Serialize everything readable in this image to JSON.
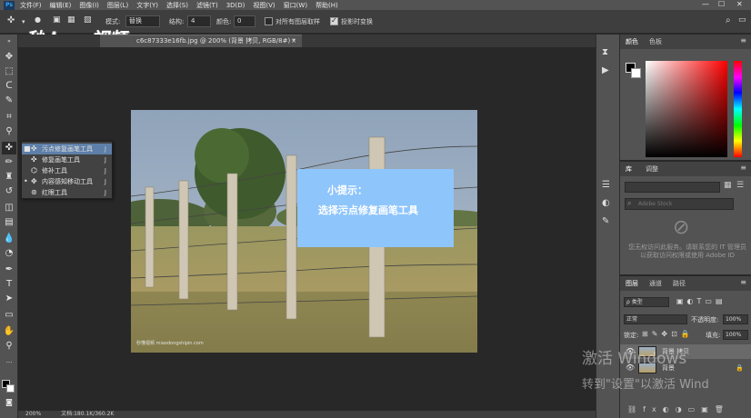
{
  "menubar": {
    "logo": "Ps",
    "items": [
      "文件(F)",
      "编辑(E)",
      "图像(I)",
      "图层(L)",
      "文字(Y)",
      "选择(S)",
      "滤镜(T)",
      "3D(D)",
      "视图(V)",
      "窗口(W)",
      "帮助(H)"
    ],
    "minimize": "—",
    "maximize": "☐",
    "close": "✕"
  },
  "options": {
    "mode_label": "模式:",
    "mode_value": "替换",
    "structure_label": "结构:",
    "structure_value": "4",
    "color_label": "颜色:",
    "color_value": "0",
    "sample_all_label": "对所有图层取样",
    "transform_label": "投影时变换"
  },
  "brand_logo": "秒dong视频",
  "document": {
    "tab_title": "c6c87333e16fb.jpg @ 200% (背景 拷贝, RGB/8#) *",
    "close": "×"
  },
  "flyout": {
    "items": [
      {
        "label": "污点修复画笔工具",
        "key": "J"
      },
      {
        "label": "修复画笔工具",
        "key": "J"
      },
      {
        "label": "修补工具",
        "key": "J"
      },
      {
        "label": "内容感知移动工具",
        "key": "J"
      },
      {
        "label": "红眼工具",
        "key": "J"
      }
    ]
  },
  "hint": {
    "title": "小提示：",
    "text": "选择污点修复画笔工具"
  },
  "photo_watermark": "秒懂视频 miaodongshipin.com",
  "statusbar": {
    "zoom": "200%",
    "doc": "文档:180.1K/360.2K"
  },
  "panels": {
    "color_tabs": [
      "颜色",
      "色板"
    ],
    "library_tabs": [
      "库",
      "调整"
    ],
    "library_search_placeholder": "Adobe Stock",
    "library_msg": "您无权访问此服务。请联系您的 IT 管理员以获取访问权限或使用 Adobe ID",
    "layers_tabs": [
      "图层",
      "通道",
      "路径"
    ],
    "kind_label": "ρ 类型",
    "blend_mode": "正常",
    "opacity_label": "不透明度:",
    "opacity_value": "100%",
    "lock_label": "锁定:",
    "fill_label": "填充:",
    "fill_value": "100%",
    "layers": [
      {
        "name": "背景 拷贝",
        "selected": true
      },
      {
        "name": "背景",
        "selected": false
      }
    ]
  },
  "activation": {
    "line1": "激活 Windows",
    "line2": "转到\"设置\"以激活 Wind"
  },
  "colors": {
    "hint_bg": "#8ec5fb",
    "flyout_selected": "#5e7fa8"
  }
}
